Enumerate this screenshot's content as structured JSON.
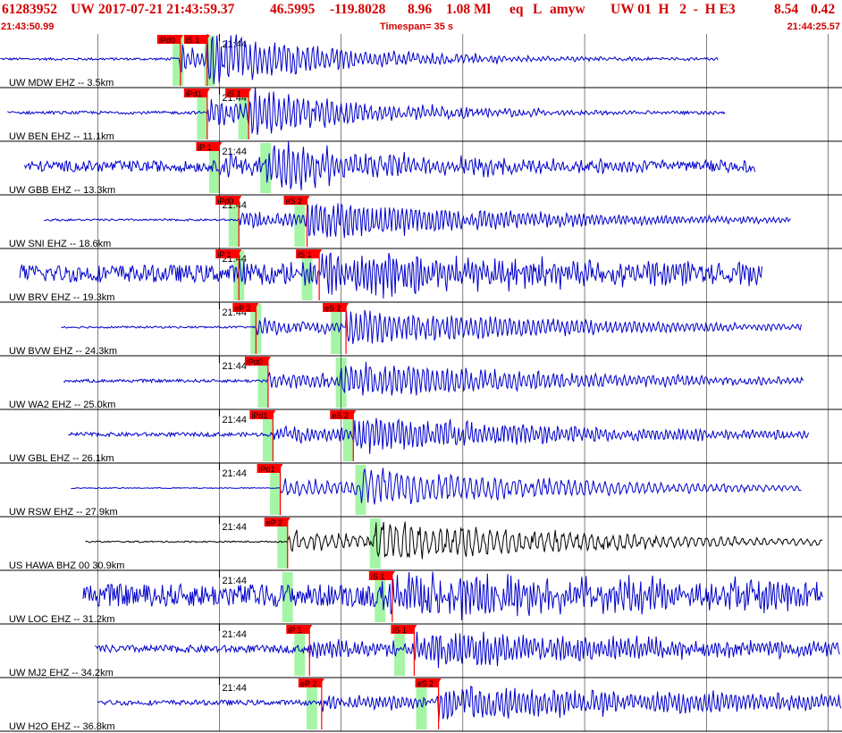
{
  "header": {
    "event_id": "61283952",
    "network": "UW",
    "origin_time": "2017-07-21 21:43:59.37",
    "latitude": "46.5995",
    "longitude": "-119.8028",
    "depth": "8.96",
    "magnitude": "1.08 Ml",
    "event_type": "eq",
    "location_flag": "L",
    "author": "amyw",
    "version_info": "UW 01  H   2  -  H E3",
    "error_a": "8.54",
    "error_b": "0.42",
    "start_time": "21:43:50.99",
    "timespan": "Timespan=  35 s",
    "end_time": "21:44:25.57"
  },
  "colors": {
    "header_text": "#d40000",
    "trace": "#0000cc",
    "trace_broadband": "#000000",
    "pick_box": "#ff0000",
    "pick_text": "#000000",
    "theoretical_window": "#a6f5a6",
    "grid": "#000000",
    "background": "#ffffff"
  },
  "chart_data": {
    "type": "line",
    "title": "",
    "xlabel": "",
    "ylabel": "",
    "time_range_s": [
      50.99,
      85.57
    ],
    "minute_tick_label": "21:44",
    "minute_tick_seconds": 60.0,
    "grid_interval_s": 5,
    "series": [
      {
        "name": "UW MDW EHZ -- 3.5km",
        "color": "trace",
        "trace_start_s": 51.0,
        "trace_end_s": 80.5,
        "noise": 0.05,
        "amp": 0.8,
        "freq": 9,
        "decay": 0.18,
        "picks": [
          {
            "label": "iPd0",
            "time_s": 58.4
          },
          {
            "label": "iS 1",
            "time_s": 59.5
          }
        ],
        "theo_windows": [
          58.3,
          59.6
        ]
      },
      {
        "name": "UW BEN EHZ -- 11.1km",
        "color": "trace",
        "trace_start_s": 51.3,
        "trace_end_s": 80.8,
        "noise": 0.06,
        "amp": 0.75,
        "freq": 9,
        "decay": 0.2,
        "picks": [
          {
            "label": "iPd1",
            "time_s": 59.5
          },
          {
            "label": "iS 1",
            "time_s": 61.2
          }
        ],
        "theo_windows": [
          59.3,
          61.0
        ]
      },
      {
        "name": "UW GBB EHZ -- 13.3km",
        "color": "trace",
        "trace_start_s": 52.0,
        "trace_end_s": 82.0,
        "noise": 0.22,
        "amp": 0.65,
        "freq": 9,
        "decay": 0.15,
        "picks": [
          {
            "label": "iP 1",
            "time_s": 60.0
          }
        ],
        "theo_windows": [
          59.8,
          61.9
        ]
      },
      {
        "name": "UW SNI EHZ -- 18.6km",
        "color": "trace",
        "trace_start_s": 52.8,
        "trace_end_s": 83.5,
        "noise": 0.04,
        "amp": 0.55,
        "freq": 10,
        "decay": 0.1,
        "picks": [
          {
            "label": "iPd0",
            "time_s": 60.8
          },
          {
            "label": "eS 2",
            "time_s": 63.6
          }
        ],
        "theo_windows": [
          60.6,
          63.3
        ]
      },
      {
        "name": "UW BRV EHZ -- 19.3km",
        "color": "trace",
        "trace_start_s": 51.8,
        "trace_end_s": 82.3,
        "noise": 0.35,
        "amp": 0.55,
        "freq": 11,
        "decay": 0.08,
        "picks": [
          {
            "label": "iP 1",
            "time_s": 60.8
          },
          {
            "label": "iS 1",
            "time_s": 64.1
          }
        ],
        "theo_windows": [
          60.8,
          63.6
        ]
      },
      {
        "name": "UW BVW EHZ -- 24.3km",
        "color": "trace",
        "trace_start_s": 53.5,
        "trace_end_s": 83.9,
        "noise": 0.04,
        "amp": 0.5,
        "freq": 9,
        "decay": 0.09,
        "picks": [
          {
            "label": "eP 2",
            "time_s": 61.5
          },
          {
            "label": "eS 2",
            "time_s": 65.2
          }
        ],
        "theo_windows": [
          61.5,
          64.8
        ]
      },
      {
        "name": "UW WA2 EHZ -- 25.0km",
        "color": "trace",
        "trace_start_s": 53.6,
        "trace_end_s": 84.0,
        "noise": 0.06,
        "amp": 0.5,
        "freq": 9,
        "decay": 0.09,
        "picks": [
          {
            "label": "iPd0",
            "time_s": 62.0
          }
        ],
        "theo_windows": [
          61.8,
          65.0
        ]
      },
      {
        "name": "UW GBL EHZ -- 26.1km",
        "color": "trace",
        "trace_start_s": 53.8,
        "trace_end_s": 84.2,
        "noise": 0.08,
        "amp": 0.5,
        "freq": 10,
        "decay": 0.09,
        "picks": [
          {
            "label": "iPd1",
            "time_s": 62.2
          },
          {
            "label": "eS 2",
            "time_s": 65.5
          }
        ],
        "theo_windows": [
          62.0,
          65.3
        ]
      },
      {
        "name": "UW RSW EHZ -- 27.9km",
        "color": "trace",
        "trace_start_s": 53.9,
        "trace_end_s": 83.9,
        "noise": 0.02,
        "amp": 0.55,
        "freq": 7,
        "decay": 0.1,
        "picks": [
          {
            "label": "iPd1",
            "time_s": 62.5
          }
        ],
        "theo_windows": [
          62.3,
          65.8
        ]
      },
      {
        "name": "US HAWA BHZ 00 30.9km",
        "color": "trace_broadband",
        "trace_start_s": 54.5,
        "trace_end_s": 84.8,
        "noise": 0.03,
        "amp": 0.6,
        "freq": 6,
        "decay": 0.1,
        "picks": [
          {
            "label": "eP 2",
            "time_s": 62.8
          }
        ],
        "theo_windows": [
          62.6,
          66.4
        ]
      },
      {
        "name": "UW LOC EHZ -- 31.2km",
        "color": "trace",
        "trace_start_s": 54.4,
        "trace_end_s": 84.8,
        "noise": 0.45,
        "amp": 0.45,
        "freq": 11,
        "decay": 0.05,
        "picks": [
          {
            "label": "iS 1",
            "time_s": 67.1
          }
        ],
        "theo_windows": [
          62.8,
          66.6
        ]
      },
      {
        "name": "UW MJ2 EHZ -- 34.2km",
        "color": "trace",
        "trace_start_s": 54.9,
        "trace_end_s": 85.5,
        "noise": 0.15,
        "amp": 0.45,
        "freq": 11,
        "decay": 0.06,
        "picks": [
          {
            "label": "iP 1",
            "time_s": 63.7
          },
          {
            "label": "iS 1",
            "time_s": 68.0
          }
        ],
        "theo_windows": [
          63.3,
          67.4
        ]
      },
      {
        "name": "UW H2O EHZ -- 36.8km",
        "color": "trace",
        "trace_start_s": 55.0,
        "trace_end_s": 85.57,
        "noise": 0.1,
        "amp": 0.45,
        "freq": 10,
        "decay": 0.05,
        "picks": [
          {
            "label": "eP 2",
            "time_s": 64.2
          },
          {
            "label": "eS 2",
            "time_s": 69.0
          }
        ],
        "theo_windows": [
          63.8,
          68.3
        ]
      }
    ]
  }
}
